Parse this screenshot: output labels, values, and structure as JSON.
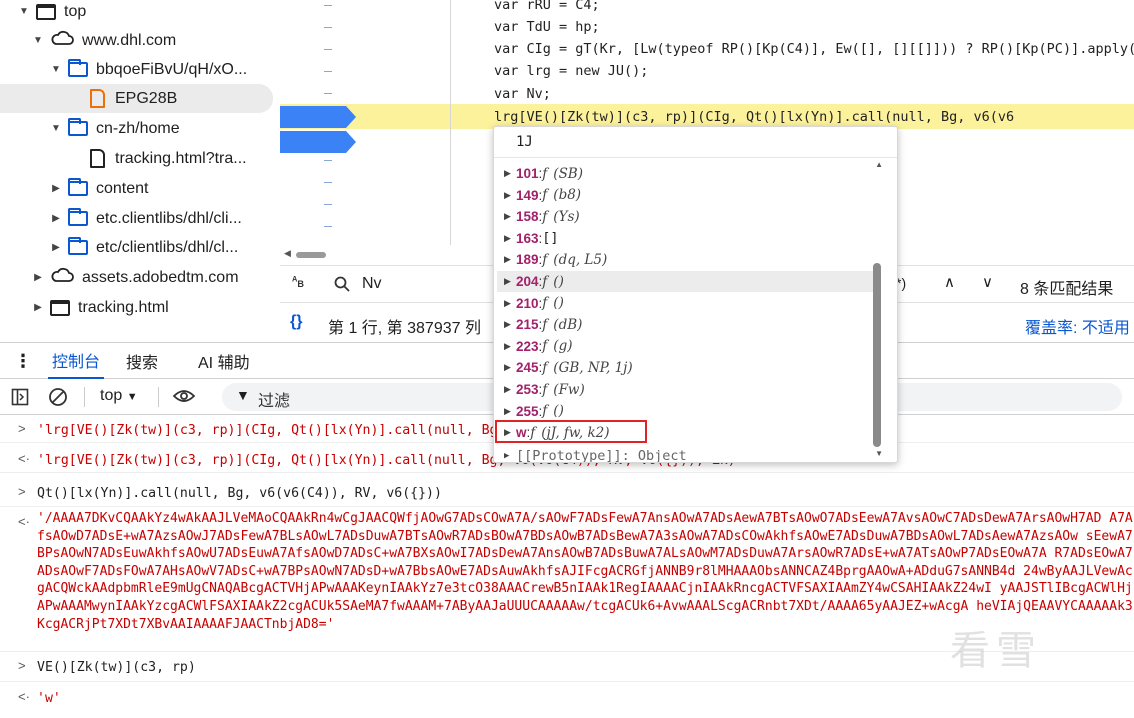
{
  "tree": {
    "items": [
      {
        "label": "top",
        "icon": "frame-icon",
        "expanded": true
      },
      {
        "label": "www.dhl.com",
        "icon": "cloud-icon",
        "expanded": true
      },
      {
        "label": "bbqoeFiBvU/qH/xO...",
        "icon": "folder-icon",
        "expanded": true
      },
      {
        "label": "EPG28B",
        "icon": "file-icon",
        "selected": true
      },
      {
        "label": "cn-zh/home",
        "icon": "folder-icon",
        "expanded": true
      },
      {
        "label": "tracking.html?tra...",
        "icon": "file-icon"
      },
      {
        "label": "content",
        "icon": "folder-icon"
      },
      {
        "label": "etc.clientlibs/dhl/cli...",
        "icon": "folder-icon"
      },
      {
        "label": "etc/clientlibs/dhl/cl...",
        "icon": "folder-icon"
      },
      {
        "label": "assets.adobedtm.com",
        "icon": "cloud-icon"
      },
      {
        "label": "tracking.html",
        "icon": "frame-icon"
      }
    ]
  },
  "editor": {
    "lines": [
      "var rRU = C4;",
      "var TdU = hp;",
      "var CIg = gT(Kr, [Lw(typeof RP()[Kp(C4)], Ew([], [][[]])) ? RP()[Kp(PC)].apply(",
      "var lrg = new JU();",
      "var Nv;",
      "lrg[VE()[Zk(tw)](c3, rp)](CIg, Qt()[lx(Yn)].call(null, Bg, v6(v6"
    ]
  },
  "search": {
    "query": "Nv",
    "match_count": "8 条匹配结果",
    "regex_partial": "*)"
  },
  "status": {
    "position": "第 1 行, 第 387937 列",
    "coverage": "覆盖率: 不适用"
  },
  "tabs": {
    "console": "控制台",
    "search": "搜索",
    "ai": "AI 辅助"
  },
  "console_toolbar": {
    "context": "top",
    "filter_placeholder": "过滤"
  },
  "console": {
    "lines": [
      {
        "prompt": ">",
        "text": "'lrg[VE()[Zk(tw)](c3, rp)](CIg, Qt()[lx(Yn)].call(null, Bg"
      },
      {
        "prompt": "<·",
        "text": "'lrg[VE()[Zk(tw)](c3, rp)](CIg, Qt()[lx(Yn)].call(null, Bg, v6(v6(C4)), RV, v6({})), Zk)'"
      },
      {
        "prompt": ">",
        "text": "Qt()[lx(Yn)].call(null, Bg, v6(v6(C4)), RV, v6({}))"
      },
      {
        "prompt": "<·",
        "text": "'/AAAA7DKvCQAAkYz4wAkAAJLVeMAoCQAAkRn4wCgJAACQWfjAOwG7ADsCOwA7A/sAOwF7ADsFewA7AnsAOwA7ADsAewA7BTsAOwO7ADsEewA7AvsAOwC7ADsDewA7ArsAOwH7AD A7AfsAOwD7ADsE+wA7AzsAOwJ7ADsFewA7BLsAOwL7ADsDuwA7BTsAOwR7ADsBOwA7BDsAOwB7ADsBewA7A3sAOwA7ADsCOwAkhfsAOwE7ADsDuwA7BDsAOwL7ADsAewA7AzsAOw sEewA7BPsAOwN7ADsEuwAkhfsAOwU7ADsEuwA7AfsAOwD7ADsC+wA7BXsAOwI7ADsDewA7AnsAOwB7ADsBuwA7ALsAOwM7ADsDuwA7ArsAOwR7ADsE+wA7ATsAOwP7ADsEOwA7A R7ADsEOwA7ADsAOwF7ADsFOwA7AHsAOwV7ADsC+wA7BPsAOwN7ADsD+wA7BbsAOwE7ADsAuwAkhfsAJIFcgACRGfjANNB9r8lMHAAAObsANNCAZ4BprgAAOwA+ADduG7sANNB4d 24wByAAJLVewAcgACQWckAAdpbmRleE9mUgCNAQABcgACTVHjAPwAAAKeynIAAkYz7e3tcO38AAACrewB5nIAAk1RegIAAAACjnIAAkRncgACTVFSAXIAAmZY4wCSAHIAAkZ24wI yAAJSTlIBcgACWlHjAPwAAAMwynIAAkYzcgACWlFSAXIAAkZ2cgACUk5SAeMA7fwAAAM+7AByAAJaUUUCAAAAAw/tcgACUk6+AvwAAALScgACRnbt7XDt/AAAA65yAAJEZ+wAcgA heVIAjQEAAVYCAAAAAk3KcgACRjPt7XDt7XBvAAIAAAAFJAACTnbjAD8='"
      },
      {
        "prompt": ">",
        "text": "VE()[Zk(tw)](c3, rp)"
      },
      {
        "prompt": "<·",
        "text": "'w'"
      }
    ]
  },
  "popup": {
    "header": "1J",
    "items": [
      {
        "key": "101",
        "sig": "(SB)"
      },
      {
        "key": "149",
        "sig": "(b8)"
      },
      {
        "key": "158",
        "sig": "(Ys)"
      },
      {
        "key": "163",
        "sig": "[]",
        "array": true
      },
      {
        "key": "189",
        "sig": "(dq, L5)"
      },
      {
        "key": "204",
        "sig": "()",
        "hovered": true
      },
      {
        "key": "210",
        "sig": "()"
      },
      {
        "key": "215",
        "sig": "(dB)"
      },
      {
        "key": "223",
        "sig": "(g)"
      },
      {
        "key": "245",
        "sig": "(GB, NP, 1j)"
      },
      {
        "key": "253",
        "sig": "(Fw)"
      },
      {
        "key": "255",
        "sig": "()"
      },
      {
        "key": "w",
        "sig": "(jJ, fw, k2)",
        "highlighted": true
      }
    ],
    "proto": "[[Prototype]]: Object"
  },
  "colors": {
    "accent": "#0b57d0",
    "highlight_line": "#fdf29c",
    "breakpoint": "#3b82f6",
    "string_red": "#c80000",
    "key_purple": "#a1216a"
  },
  "watermark": "看雪"
}
